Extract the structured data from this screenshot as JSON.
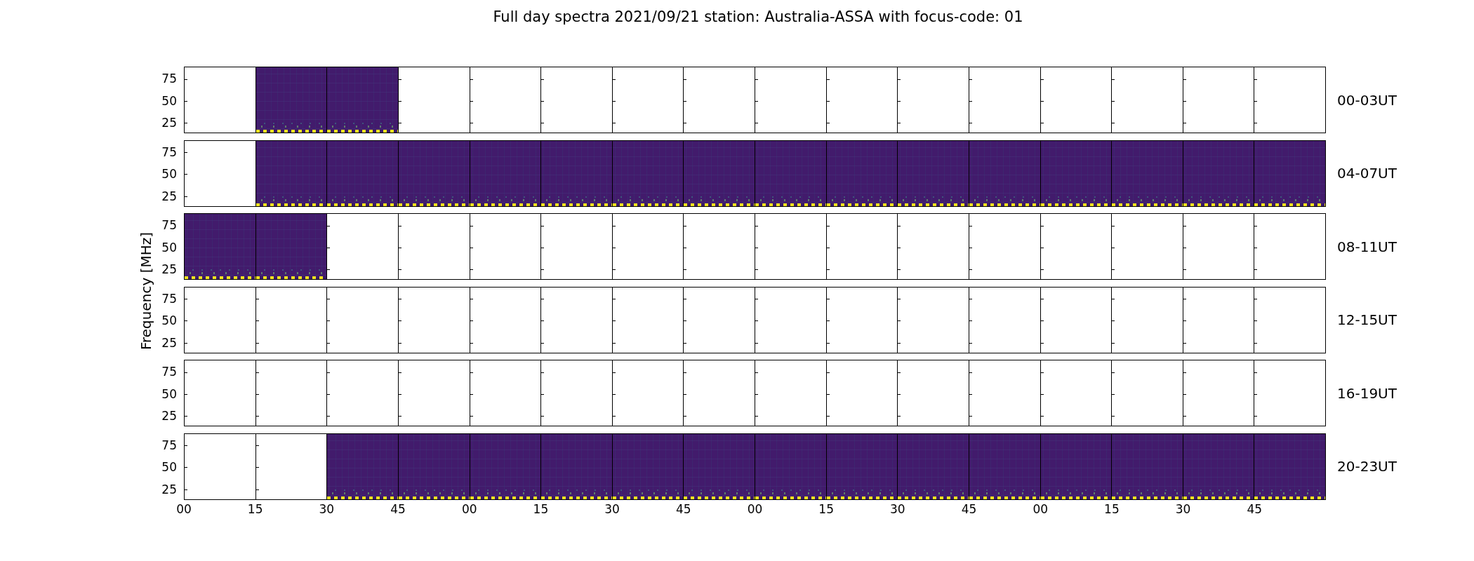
{
  "title": "Full day spectra 2021/09/21 station: Australia-ASSA with focus-code: 01",
  "y_axis_label": "Frequency [MHz]",
  "rows": [
    {
      "label": "00-03UT",
      "y_ticks": [
        "75",
        "50",
        "25"
      ],
      "panels": [
        {
          "kind": "empty"
        },
        {
          "kind": "spectrogram"
        },
        {
          "kind": "spectrogram"
        },
        {
          "kind": "empty"
        },
        {
          "kind": "empty"
        },
        {
          "kind": "empty"
        },
        {
          "kind": "empty"
        },
        {
          "kind": "empty"
        },
        {
          "kind": "empty"
        },
        {
          "kind": "empty"
        },
        {
          "kind": "empty"
        },
        {
          "kind": "empty"
        },
        {
          "kind": "empty"
        },
        {
          "kind": "empty"
        },
        {
          "kind": "empty"
        },
        {
          "kind": "empty"
        }
      ]
    },
    {
      "label": "04-07UT",
      "y_ticks": [
        "75",
        "50",
        "25"
      ],
      "panels": [
        {
          "kind": "empty"
        },
        {
          "kind": "spectrogram"
        },
        {
          "kind": "spectrogram"
        },
        {
          "kind": "spectrogram"
        },
        {
          "kind": "spectrogram"
        },
        {
          "kind": "spectrogram"
        },
        {
          "kind": "spectrogram"
        },
        {
          "kind": "spectrogram"
        },
        {
          "kind": "spectrogram"
        },
        {
          "kind": "spectrogram"
        },
        {
          "kind": "spectrogram"
        },
        {
          "kind": "spectrogram"
        },
        {
          "kind": "spectrogram"
        },
        {
          "kind": "spectrogram"
        },
        {
          "kind": "spectrogram"
        },
        {
          "kind": "spectrogram"
        }
      ]
    },
    {
      "label": "08-11UT",
      "y_ticks": [
        "75",
        "50",
        "25"
      ],
      "panels": [
        {
          "kind": "spectrogram"
        },
        {
          "kind": "spectrogram"
        },
        {
          "kind": "empty"
        },
        {
          "kind": "empty"
        },
        {
          "kind": "empty"
        },
        {
          "kind": "empty"
        },
        {
          "kind": "empty"
        },
        {
          "kind": "empty"
        },
        {
          "kind": "empty"
        },
        {
          "kind": "empty"
        },
        {
          "kind": "empty"
        },
        {
          "kind": "empty"
        },
        {
          "kind": "empty"
        },
        {
          "kind": "empty"
        },
        {
          "kind": "empty"
        },
        {
          "kind": "empty"
        }
      ]
    },
    {
      "label": "12-15UT",
      "y_ticks": [
        "75",
        "50",
        "25"
      ],
      "panels": [
        {
          "kind": "empty"
        },
        {
          "kind": "empty"
        },
        {
          "kind": "empty"
        },
        {
          "kind": "empty"
        },
        {
          "kind": "empty"
        },
        {
          "kind": "empty"
        },
        {
          "kind": "empty"
        },
        {
          "kind": "empty"
        },
        {
          "kind": "empty"
        },
        {
          "kind": "empty"
        },
        {
          "kind": "empty"
        },
        {
          "kind": "empty"
        },
        {
          "kind": "empty"
        },
        {
          "kind": "empty"
        },
        {
          "kind": "empty"
        },
        {
          "kind": "empty"
        }
      ]
    },
    {
      "label": "16-19UT",
      "y_ticks": [
        "75",
        "50",
        "25"
      ],
      "panels": [
        {
          "kind": "empty"
        },
        {
          "kind": "empty"
        },
        {
          "kind": "empty"
        },
        {
          "kind": "empty"
        },
        {
          "kind": "empty"
        },
        {
          "kind": "empty"
        },
        {
          "kind": "empty"
        },
        {
          "kind": "empty"
        },
        {
          "kind": "empty"
        },
        {
          "kind": "empty"
        },
        {
          "kind": "empty"
        },
        {
          "kind": "empty"
        },
        {
          "kind": "empty"
        },
        {
          "kind": "empty"
        },
        {
          "kind": "empty"
        },
        {
          "kind": "empty"
        }
      ]
    },
    {
      "label": "20-23UT",
      "y_ticks": [
        "75",
        "50",
        "25"
      ],
      "panels": [
        {
          "kind": "empty"
        },
        {
          "kind": "empty"
        },
        {
          "kind": "spectrogram"
        },
        {
          "kind": "spectrogram"
        },
        {
          "kind": "spectrogram"
        },
        {
          "kind": "spectrogram"
        },
        {
          "kind": "spectrogram"
        },
        {
          "kind": "spectrogram"
        },
        {
          "kind": "spectrogram"
        },
        {
          "kind": "spectrogram"
        },
        {
          "kind": "spectrogram"
        },
        {
          "kind": "spectrogram"
        },
        {
          "kind": "spectrogram"
        },
        {
          "kind": "spectrogram"
        },
        {
          "kind": "spectrogram"
        },
        {
          "kind": "spectrogram"
        }
      ]
    }
  ],
  "x_ticks": [
    "00",
    "15",
    "30",
    "45",
    "00",
    "15",
    "30",
    "45",
    "00",
    "15",
    "30",
    "45",
    "00",
    "15",
    "30",
    "45"
  ]
}
